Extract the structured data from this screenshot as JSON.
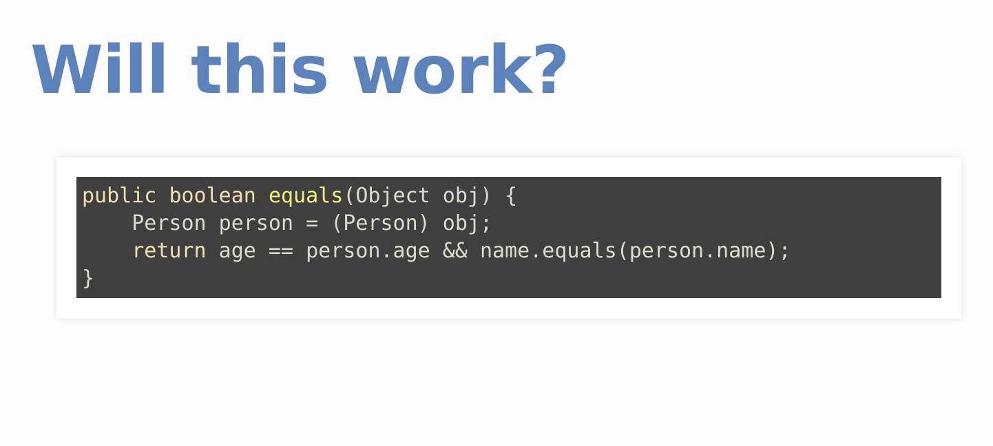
{
  "slide": {
    "title": "Will this work?"
  },
  "code": {
    "language": "java",
    "colors": {
      "background": "#3f3f3f",
      "keyword": "#f0dfaf",
      "function": "#f0f27c",
      "plain": "#dcdccc",
      "title": "#5b82bb"
    },
    "lines": [
      {
        "indent": "",
        "kw1": "public",
        "s1": " ",
        "kw2": "boolean",
        "s2": " ",
        "fn": "equals",
        "rest": "(Object obj) {"
      },
      {
        "text": "    Person person = (Person) obj;"
      },
      {
        "indent": "    ",
        "kw": "return",
        "rest": " age == person.age && name.equals(person.name);"
      },
      {
        "text": "}"
      }
    ]
  }
}
